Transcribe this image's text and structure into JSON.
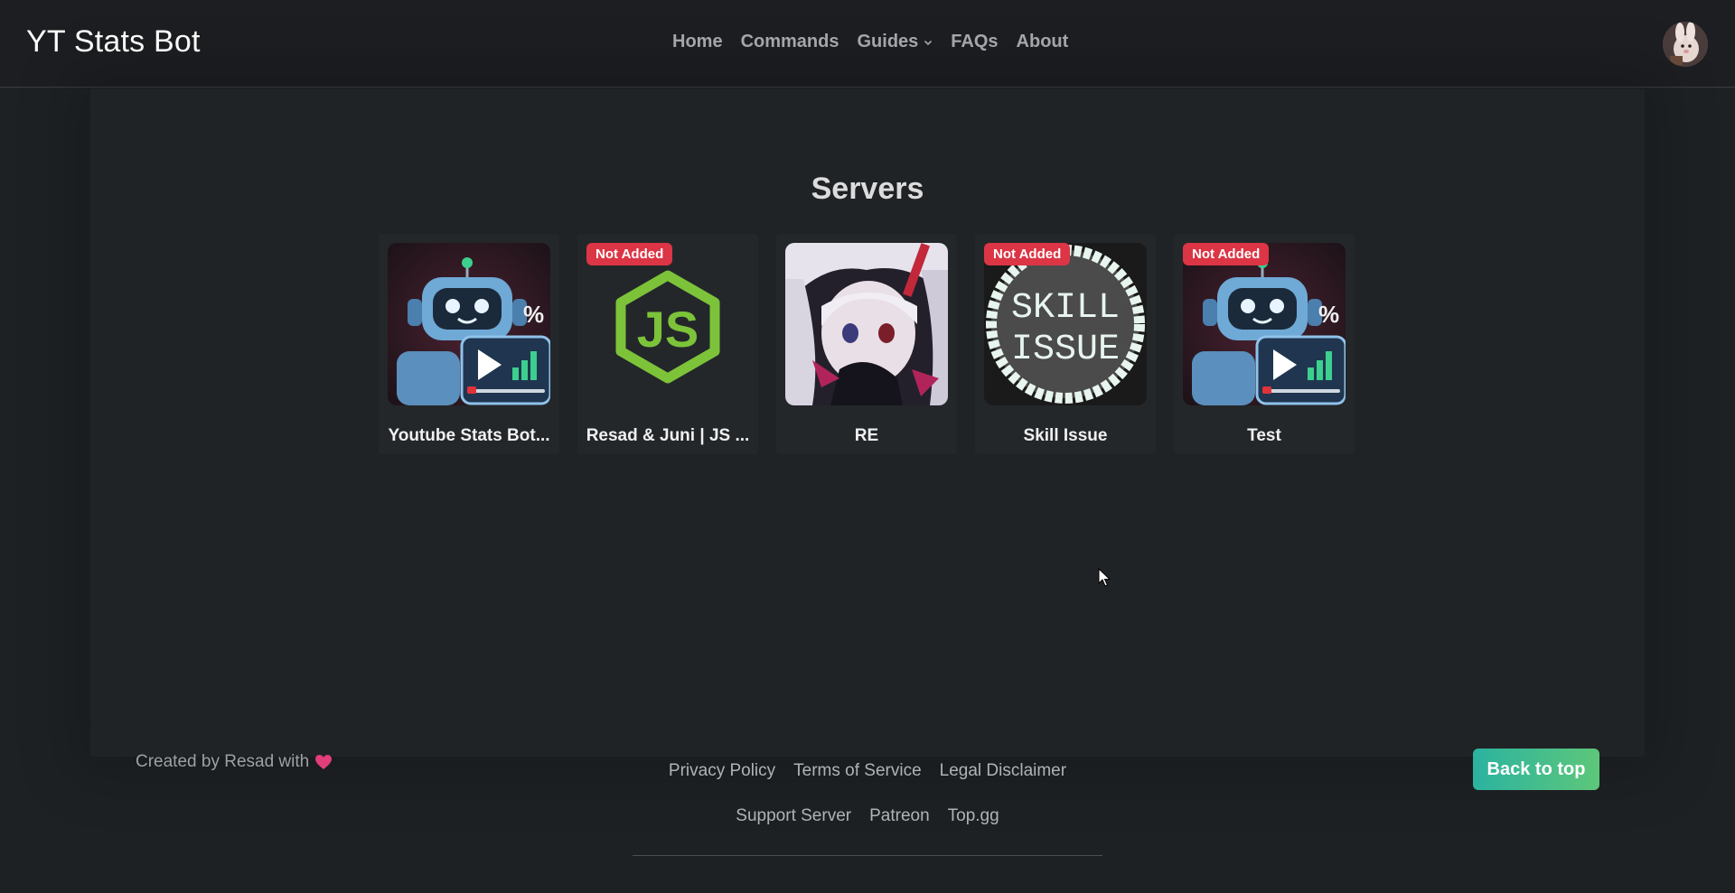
{
  "navbar": {
    "brand": "YT Stats Bot",
    "links": [
      {
        "label": "Home"
      },
      {
        "label": "Commands"
      },
      {
        "label": "Guides",
        "has_dropdown": true
      },
      {
        "label": "FAQs"
      },
      {
        "label": "About"
      }
    ]
  },
  "main": {
    "title": "Servers",
    "servers": [
      {
        "name": "Youtube Stats Bot...",
        "badge": "",
        "icon": "robot-stats-icon"
      },
      {
        "name": "Resad & Juni | JS ...",
        "badge": "Not Added",
        "icon": "nodejs-icon"
      },
      {
        "name": "RE",
        "badge": "",
        "icon": "anime-avatar-icon"
      },
      {
        "name": "Skill Issue",
        "badge": "Not Added",
        "icon": "skill-issue-icon"
      },
      {
        "name": "Test",
        "badge": "Not Added",
        "icon": "robot-stats-icon"
      }
    ]
  },
  "footer": {
    "credit": "Created by Resad with",
    "links_row1": [
      "Privacy Policy",
      "Terms of Service",
      "Legal Disclaimer"
    ],
    "links_row2": [
      "Support Server",
      "Patreon",
      "Top.gg"
    ],
    "back_to_top": "Back to top"
  },
  "colors": {
    "background": "#1e2124",
    "badge": "#dc3545",
    "accent_gradient_start": "#2bb3a0",
    "accent_gradient_end": "#5dc77a"
  }
}
